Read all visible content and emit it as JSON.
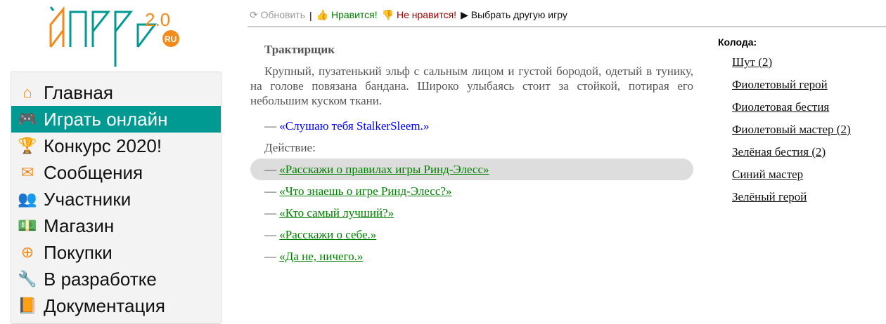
{
  "logo": {
    "text": "Йапеp",
    "version": "2.0",
    "tld": "RU"
  },
  "sidebar": {
    "items": [
      {
        "label": "Главная",
        "icon": "home-icon",
        "glyph": "⌂"
      },
      {
        "label": "Играть онлайн",
        "icon": "gamepad-icon",
        "glyph": "🎮",
        "active": true
      },
      {
        "label": "Конкурс 2020!",
        "icon": "trophy-icon",
        "glyph": "🏆"
      },
      {
        "label": "Сообщения",
        "icon": "envelope-icon",
        "glyph": "✉"
      },
      {
        "label": "Участники",
        "icon": "users-icon",
        "glyph": "👥"
      },
      {
        "label": "Магазин",
        "icon": "money-icon",
        "glyph": "💵"
      },
      {
        "label": "Покупки",
        "icon": "plus-circle-icon",
        "glyph": "⊕"
      },
      {
        "label": "В разработке",
        "icon": "wrench-icon",
        "glyph": "🔧"
      },
      {
        "label": "Документация",
        "icon": "book-icon",
        "glyph": "📙"
      }
    ]
  },
  "toolbar": {
    "refresh": "Обновить",
    "divider": "|",
    "like": "Нравится!",
    "dislike": "Не нравится!",
    "choose": "Выбрать другую игру",
    "colors": {
      "like": "#008000",
      "dislike": "#a00000",
      "refresh": "#999999"
    }
  },
  "main": {
    "title": "Трактирщик",
    "description": "Крупный, пузатенький эльф с сальным лицом и густой бородой, одетый в тунику, на голове повязана бандана. Широко улыбаясь стоит за стойкой, потирая его небольшим куском ткани.",
    "dash": "—",
    "reply": "«Слушаю тебя StalkerSleem.»",
    "action_label": "Действие:",
    "actions": [
      "«Расскажи о правилах игры Ринд-Элесс»",
      "«Что знаешь о игре Ринд-Элесс?»",
      "«Кто самый лучший?»",
      "«Расскажи о себе.»",
      "«Да не, ничего.»"
    ]
  },
  "deck": {
    "label": "Колода:",
    "cards": [
      "Шут (2)",
      "Фиолетовый герой",
      "Фиолетовая бестия",
      "Фиолетовый мастер (2)",
      "Зелёная бестия (2)",
      "Синий мастер",
      "Зелёный герой"
    ]
  }
}
